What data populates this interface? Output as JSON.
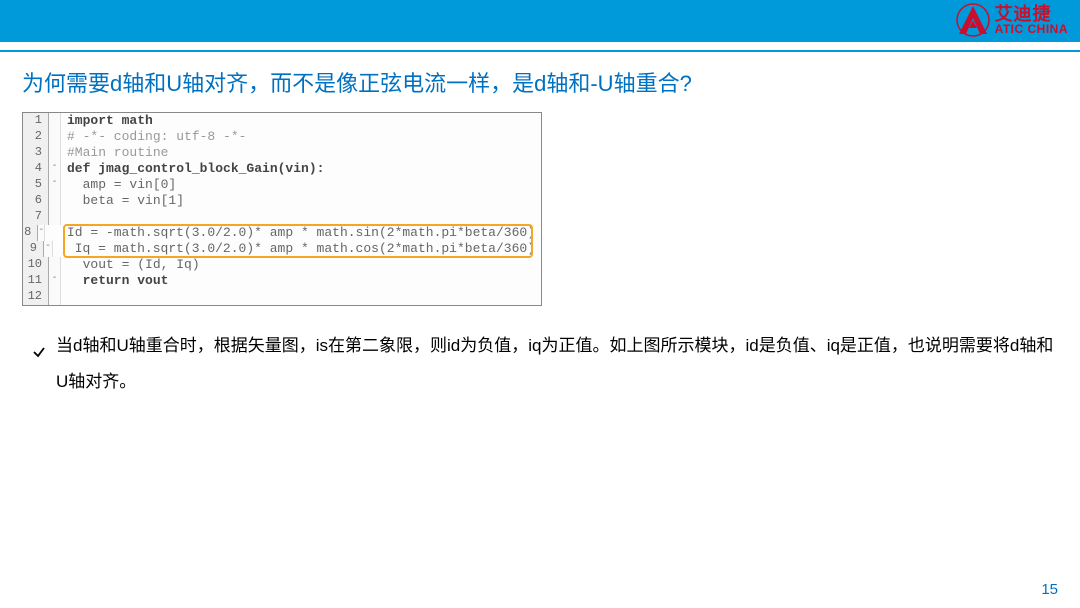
{
  "logo": {
    "cn": "艾迪捷",
    "en": "ATIC CHINA"
  },
  "title": "为何需要d轴和U轴对齐，而不是像正弦电流一样，是d轴和-U轴重合?",
  "code": {
    "lines": [
      {
        "n": "1",
        "fold": "",
        "t": "import math",
        "cls": "kw"
      },
      {
        "n": "2",
        "fold": "",
        "t": "# -*- coding: utf-8 -*-",
        "cls": "cm"
      },
      {
        "n": "3",
        "fold": "",
        "t": "#Main routine",
        "cls": "cm"
      },
      {
        "n": "4",
        "fold": "-",
        "t": "def jmag_control_block_Gain(vin):",
        "cls": "kw"
      },
      {
        "n": "5",
        "fold": "-",
        "t": "  amp = vin[0]",
        "cls": ""
      },
      {
        "n": "6",
        "fold": "",
        "t": "  beta = vin[1]",
        "cls": ""
      },
      {
        "n": "7",
        "fold": "",
        "t": " ",
        "cls": ""
      },
      {
        "n": "8",
        "fold": "-",
        "t": "  Id = -math.sqrt(3.0/2.0)* amp * math.sin(2*math.pi*beta/360)",
        "cls": ""
      },
      {
        "n": "9",
        "fold": "-",
        "t": "  Iq = math.sqrt(3.0/2.0)* amp * math.cos(2*math.pi*beta/360)",
        "cls": ""
      },
      {
        "n": "10",
        "fold": "",
        "t": "  vout = (Id, Iq)",
        "cls": ""
      },
      {
        "n": "11",
        "fold": "-",
        "t": "  return vout",
        "cls": "kw"
      },
      {
        "n": "12",
        "fold": "",
        "t": " ",
        "cls": ""
      }
    ]
  },
  "bullet": "当d轴和U轴重合时，根据矢量图，is在第二象限，则id为负值，iq为正值。如上图所示模块，id是负值、iq是正值，也说明需要将d轴和U轴对齐。",
  "page_num": "15"
}
